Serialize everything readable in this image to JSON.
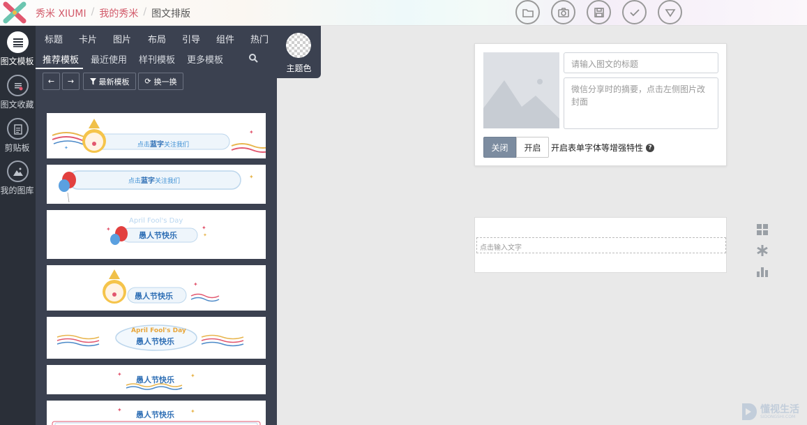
{
  "header": {
    "breadcrumbs": [
      "秀米 XIUMI",
      "我的秀米",
      "图文排版"
    ],
    "icons": [
      "folder-icon",
      "camera-icon",
      "save-icon",
      "check-icon",
      "dropdown-icon"
    ]
  },
  "rail": {
    "items": [
      {
        "label": "图文模板",
        "icon": "list-icon",
        "active": true
      },
      {
        "label": "图文收藏",
        "icon": "favorite-icon"
      },
      {
        "label": "剪贴板",
        "icon": "clipboard-icon"
      },
      {
        "label": "我的图库",
        "icon": "image-icon"
      }
    ]
  },
  "panel": {
    "tabs_main": [
      "标题",
      "卡片",
      "图片",
      "布局",
      "引导",
      "组件",
      "热门"
    ],
    "tabs_sub": [
      "推荐模板",
      "最近使用",
      "样刊模板",
      "更多模板"
    ],
    "btn_latest": "最新模板",
    "btn_swap": "换一换",
    "templates": [
      {
        "text_a": "点击",
        "text_b": "蓝字",
        "text_c": "关注我们"
      },
      {
        "text_a": "点击",
        "text_b": "蓝字",
        "text_c": "关注我们"
      },
      {
        "text_top": "April Fool's Day",
        "text_main": "愚人节快乐"
      },
      {
        "text_main": "愚人节快乐"
      },
      {
        "text_top": "April Fool's Day",
        "text_main": "愚人节快乐"
      },
      {
        "text_main": "愚人节快乐"
      },
      {
        "text_main": "愚人节快乐"
      }
    ]
  },
  "theme": {
    "label": "主题色"
  },
  "editor": {
    "title_placeholder": "请输入图文的标题",
    "summary_placeholder": "微信分享时的摘要，点击左侧图片改封面",
    "btn_off": "关闭",
    "btn_on": "开启",
    "feature_text": "开启表单字体等增强特性",
    "text_placeholder": "点击输入文字"
  },
  "watermark": {
    "text": "懂视生活",
    "sub": "SIDONGSHI.COM"
  }
}
